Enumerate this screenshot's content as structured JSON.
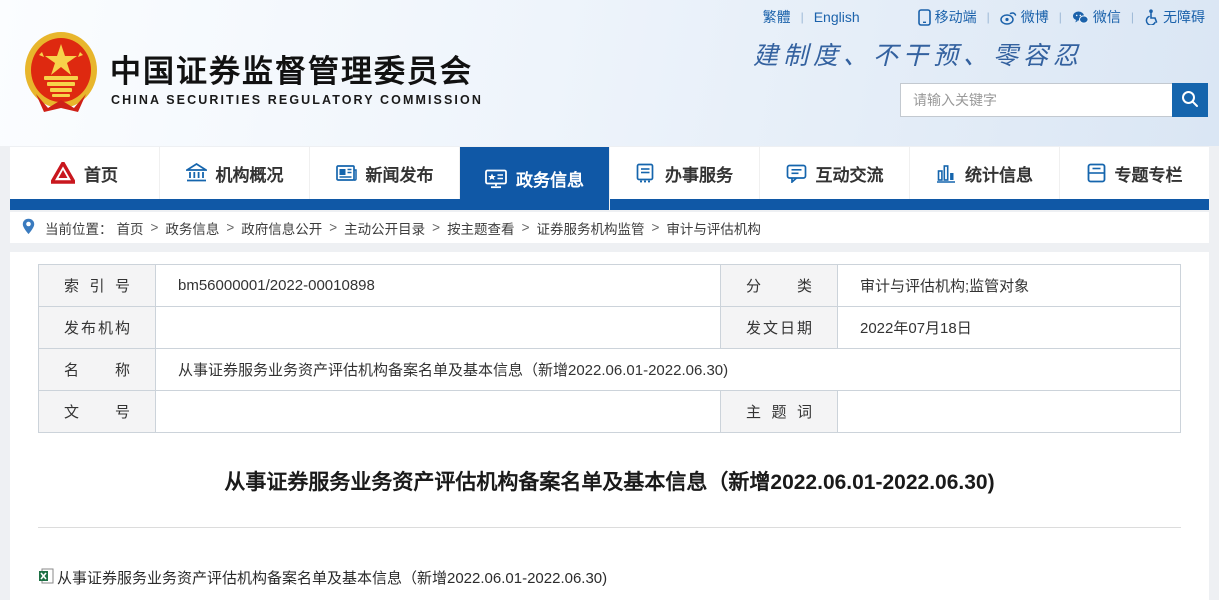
{
  "top_bar": {
    "traditional": "繁體",
    "english": "English",
    "mobile": "移动端",
    "weibo": "微博",
    "wechat": "微信",
    "accessibility": "无障碍",
    "separator": "|"
  },
  "header": {
    "title_cn": "中国证券监督管理委员会",
    "title_en": "CHINA SECURITIES REGULATORY COMMISSION",
    "slogan": "建制度、不干预、零容忍",
    "search_placeholder": "请输入关键字"
  },
  "nav": {
    "items": [
      {
        "label": "首页",
        "icon": "csrc-logo-icon",
        "active": false
      },
      {
        "label": "机构概况",
        "icon": "bank-icon",
        "active": false
      },
      {
        "label": "新闻发布",
        "icon": "news-icon",
        "active": false
      },
      {
        "label": "政务信息",
        "icon": "monitor-icon",
        "active": true
      },
      {
        "label": "办事服务",
        "icon": "services-icon",
        "active": false
      },
      {
        "label": "互动交流",
        "icon": "chat-icon",
        "active": false
      },
      {
        "label": "统计信息",
        "icon": "bar-chart-icon",
        "active": false
      },
      {
        "label": "专题专栏",
        "icon": "topics-icon",
        "active": false
      }
    ]
  },
  "breadcrumb": {
    "label": "当前位置：",
    "separator": ">",
    "items": [
      "首页",
      "政务信息",
      "政府信息公开",
      "主动公开目录",
      "按主题查看",
      "证券服务机构监管",
      "审计与评估机构"
    ]
  },
  "info_table": {
    "index_label": "索引号",
    "index_value": "bm56000001/2022-00010898",
    "category_label": "分类",
    "category_value": "审计与评估机构;监管对象",
    "publisher_label": "发布机构",
    "publisher_value": "",
    "date_label": "发文日期",
    "date_value": "2022年07月18日",
    "name_label": "名称",
    "name_value": "从事证券服务业务资产评估机构备案名单及基本信息（新增2022.06.01-2022.06.30)",
    "doc_no_label": "文号",
    "doc_no_value": "",
    "subject_label": "主题词",
    "subject_value": ""
  },
  "article": {
    "title": "从事证券服务业务资产评估机构备案名单及基本信息（新增2022.06.01-2022.06.30)",
    "attachment_name": "从事证券服务业务资产评估机构备案名单及基本信息（新增2022.06.01-2022.06.30)"
  },
  "colors": {
    "accent_blue": "#1058a6",
    "link_blue": "#1b62ab",
    "slogan_blue": "#33619f",
    "logo_red": "#de2910",
    "csrc_red": "#c9171e",
    "excel_green": "#1e7145"
  }
}
